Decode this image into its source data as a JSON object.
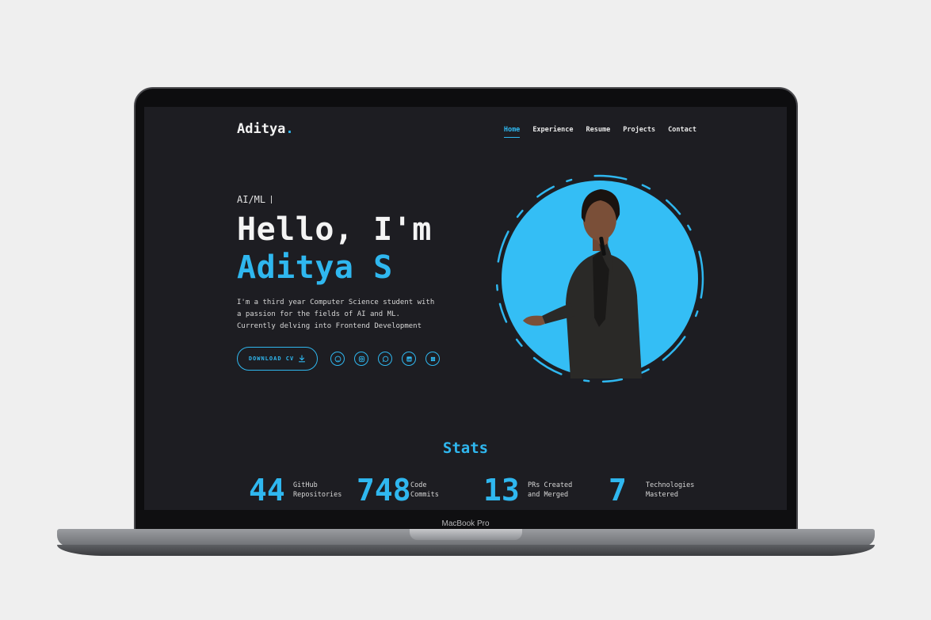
{
  "device": {
    "model": "MacBook Pro"
  },
  "site": {
    "logo_text": "Aditya",
    "logo_dot": ".",
    "nav": [
      {
        "label": "Home"
      },
      {
        "label": "Experience"
      },
      {
        "label": "Resume"
      },
      {
        "label": "Projects"
      },
      {
        "label": "Contact"
      }
    ],
    "hero": {
      "role": "AI/ML",
      "greeting": "Hello, I'm",
      "name": "Aditya S",
      "description": "I'm a third year Computer Science student with a passion for the fields of AI and ML. Currently delving into Frontend Development",
      "cv_button": "DOWNLOAD CV",
      "socials": [
        "github-icon",
        "instagram-icon",
        "whatsapp-icon",
        "linkedin-icon",
        "apps-icon"
      ]
    },
    "stats": {
      "title": "Stats",
      "items": [
        {
          "value": "44",
          "label_1": "GitHub",
          "label_2": "Repositories"
        },
        {
          "value": "748",
          "label_1": "Code",
          "label_2": "Commits"
        },
        {
          "value": "13",
          "label_1": "PRs Created",
          "label_2": "and Merged"
        },
        {
          "value": "7",
          "label_1": "Technologies",
          "label_2": "Mastered"
        }
      ]
    }
  },
  "colors": {
    "accent": "#2fb7ef",
    "background": "#1d1d22",
    "text": "#f2f2f2"
  }
}
